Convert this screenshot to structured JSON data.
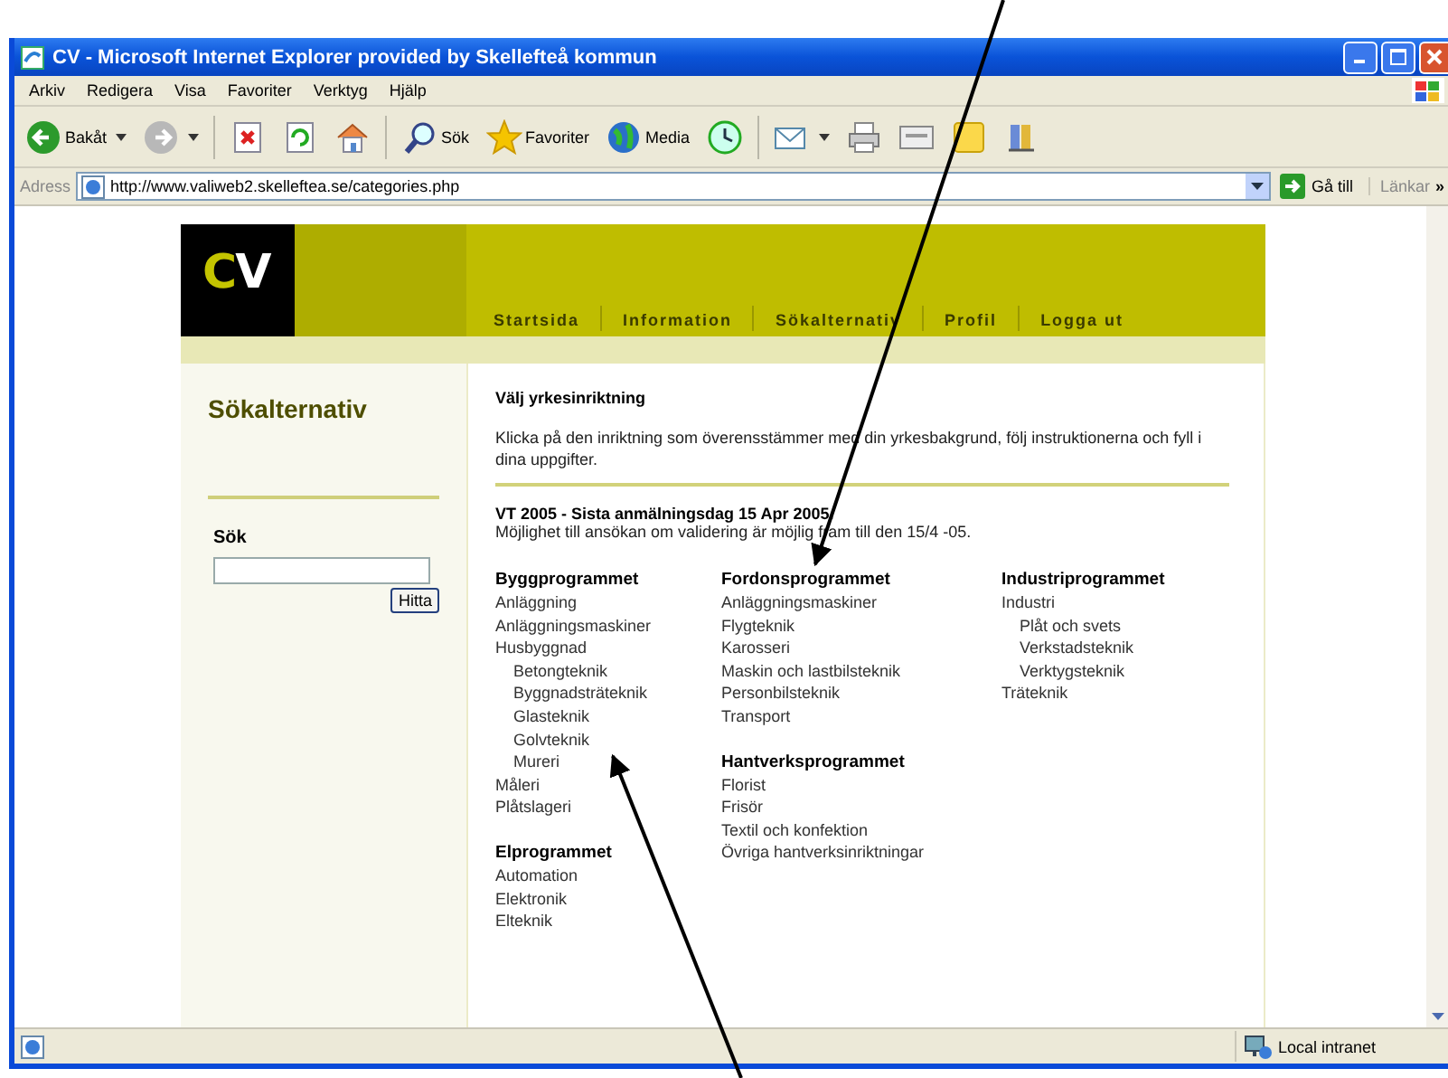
{
  "window": {
    "title": "CV - Microsoft Internet Explorer provided by Skellefteå kommun"
  },
  "menu": [
    "Arkiv",
    "Redigera",
    "Visa",
    "Favoriter",
    "Verktyg",
    "Hjälp"
  ],
  "toolbar": [
    {
      "kind": "back",
      "label": "Bakåt"
    },
    {
      "kind": "forward"
    },
    {
      "kind": "stop"
    },
    {
      "kind": "refresh"
    },
    {
      "kind": "home"
    },
    {
      "kind": "search",
      "label": "Sök"
    },
    {
      "kind": "favorites",
      "label": "Favoriter"
    },
    {
      "kind": "media",
      "label": "Media"
    },
    {
      "kind": "history"
    },
    {
      "kind": "mail"
    },
    {
      "kind": "print"
    },
    {
      "kind": "edit"
    },
    {
      "kind": "note"
    },
    {
      "kind": "messenger"
    }
  ],
  "address": {
    "label": "Adress",
    "url": "http://www.valiweb2.skelleftea.se/categories.php",
    "go": "Gå till",
    "links": "Länkar",
    "more": "»"
  },
  "logo": [
    {
      "text": "C",
      "color": "#c4c400"
    },
    {
      "text": "V",
      "color": "#ffffff"
    }
  ],
  "nav": [
    "Startsida",
    "Information",
    "Sökalternativ",
    "Profil",
    "Logga ut"
  ],
  "sidebar": {
    "title": "Sökalternativ",
    "search_label": "Sök",
    "search_button": "Hitta"
  },
  "content": {
    "heading": "Välj yrkesinriktning",
    "intro": "Klicka på den inriktning som överensstämmer med din yrkesbakgrund, följ instruktionerna och fyll i dina uppgifter.",
    "notice_title": "VT 2005 - Sista anmälningsdag 15 Apr 2005.",
    "notice_text": "Möjlighet till ansökan om validering är möjlig fram till den 15/4 -05.",
    "columns": [
      [
        {
          "title": "Byggprogrammet",
          "items": [
            {
              "label": "Anläggning"
            },
            {
              "label": "Anläggningsmaskiner"
            },
            {
              "label": "Husbyggnad",
              "children": [
                {
                  "label": "Betongteknik"
                },
                {
                  "label": "Byggnadsträteknik"
                },
                {
                  "label": "Glasteknik"
                },
                {
                  "label": "Golvteknik"
                },
                {
                  "label": "Mureri"
                }
              ]
            },
            {
              "label": "Måleri"
            },
            {
              "label": "Plåtslageri"
            }
          ]
        },
        {
          "title": "Elprogrammet",
          "items": [
            {
              "label": "Automation"
            },
            {
              "label": "Elektronik"
            },
            {
              "label": "Elteknik"
            }
          ]
        }
      ],
      [
        {
          "title": "Fordonsprogrammet",
          "items": [
            {
              "label": "Anläggningsmaskiner"
            },
            {
              "label": "Flygteknik"
            },
            {
              "label": "Karosseri"
            },
            {
              "label": "Maskin och lastbilsteknik"
            },
            {
              "label": "Personbilsteknik"
            },
            {
              "label": "Transport"
            }
          ]
        },
        {
          "title": "Hantverksprogrammet",
          "items": [
            {
              "label": "Florist"
            },
            {
              "label": "Frisör"
            },
            {
              "label": "Textil och konfektion"
            },
            {
              "label": "Övriga hantverksinriktningar"
            }
          ]
        }
      ],
      [
        {
          "title": "Industriprogrammet",
          "items": [
            {
              "label": "Industri",
              "children": [
                {
                  "label": "Plåt och svets"
                },
                {
                  "label": "Verkstadsteknik"
                },
                {
                  "label": "Verktygsteknik"
                }
              ]
            },
            {
              "label": "Träteknik"
            }
          ]
        }
      ]
    ]
  },
  "status_bar": {
    "zone": "Local intranet"
  }
}
